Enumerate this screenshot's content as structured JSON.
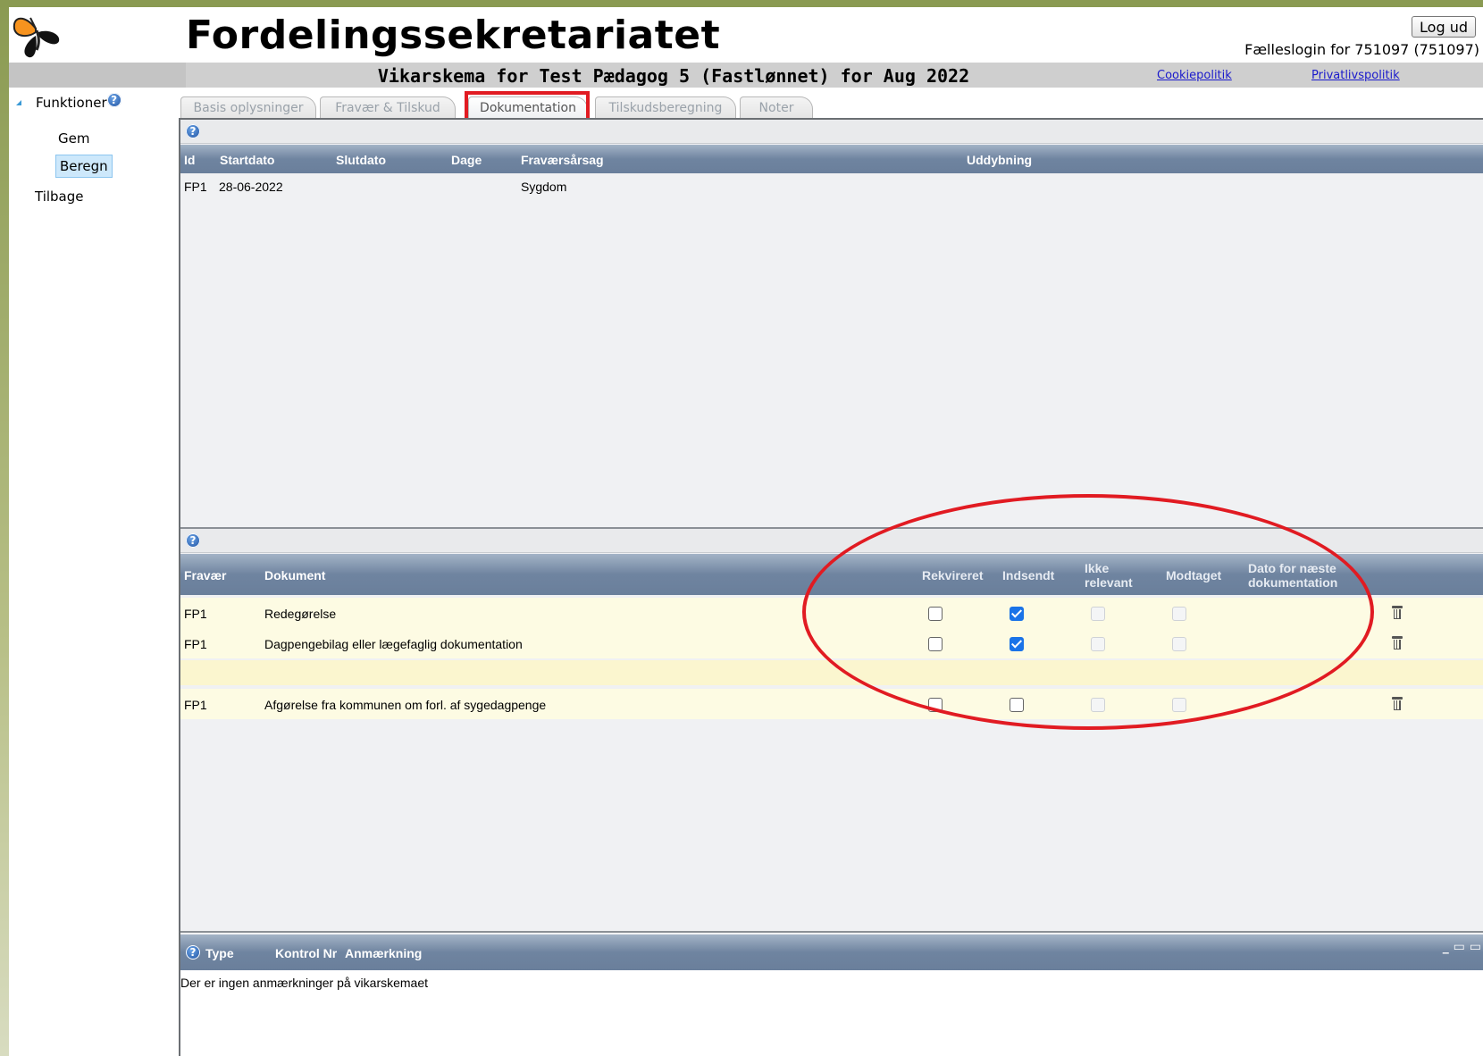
{
  "header": {
    "title": "Fordelingssekretariatet",
    "logout_label": "Log ud",
    "login_info": "Fælleslogin for 751097 (751097)",
    "subtitle": "Vikarskema for Test Pædagog 5 (Fastlønnet) for Aug 2022",
    "links": {
      "cookie": "Cookiepolitik",
      "privacy": "Privatlivspolitik"
    }
  },
  "sidebar": {
    "heading": "Funktioner",
    "items": [
      {
        "label": "Gem"
      },
      {
        "label": "Beregn"
      },
      {
        "label": "Tilbage"
      }
    ]
  },
  "tabs": [
    {
      "label": "Basis oplysninger"
    },
    {
      "label": "Fravær & Tilskud"
    },
    {
      "label": "Dokumentation"
    },
    {
      "label": "Tilskudsberegning"
    },
    {
      "label": "Noter"
    }
  ],
  "absence_grid": {
    "columns": {
      "id": "Id",
      "start": "Startdato",
      "end": "Slutdato",
      "days": "Dage",
      "reason": "Fraværsårsag",
      "detail": "Uddybning"
    },
    "rows": [
      {
        "id": "FP1",
        "start": "28-06-2022",
        "end": "",
        "days": "",
        "reason": "Sygdom",
        "detail": ""
      }
    ]
  },
  "documents_grid": {
    "columns": {
      "absence": "Fravær",
      "document": "Dokument",
      "requested": "Rekvireret",
      "sent": "Indsendt",
      "not_relevant_1": "Ikke",
      "not_relevant_2": "relevant",
      "received": "Modtaget",
      "next_date_1": "Dato for næste",
      "next_date_2": "dokumentation"
    },
    "rows": [
      {
        "absence": "FP1",
        "document": "Redegørelse",
        "requested": false,
        "sent": true
      },
      {
        "absence": "FP1",
        "document": "Dagpengebilag eller lægefaglig dokumentation",
        "requested": false,
        "sent": true
      },
      {
        "absence": "FP1",
        "document": "Afgørelse fra kommunen om forl. af sygedagpenge",
        "requested": false,
        "sent": false
      }
    ]
  },
  "notes_grid": {
    "columns": {
      "type": "Type",
      "control": "Kontrol Nr",
      "remark": "Anmærkning"
    },
    "empty_message": "Der er ingen anmærkninger på vikarskemaet"
  },
  "icons": {
    "help": "help-icon",
    "delete": "trash-icon",
    "collapse": "triangle-icon"
  },
  "colors": {
    "highlight": "#e11b22",
    "grid_header": "#6f84a0",
    "row_bg": "#fdfbe3",
    "checked": "#1a73e8"
  }
}
